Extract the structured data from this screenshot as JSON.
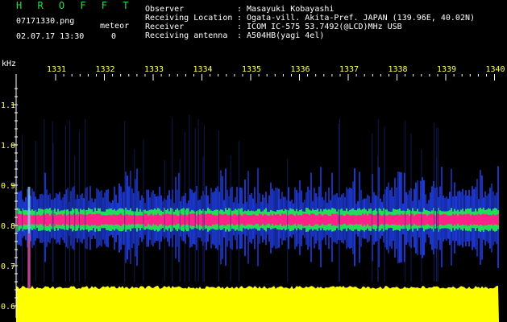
{
  "app": {
    "title": "H R O F F T"
  },
  "file": {
    "name": "07171330.png",
    "datetime": "02.07.17 13:30"
  },
  "meteor": {
    "label": "meteor",
    "count": "0"
  },
  "info": {
    "labels": [
      "Observer",
      "Receiving Location",
      "Receiver",
      "Receiving antenna"
    ],
    "values": [
      ": Masayuki Kobayashi",
      ": Ogata-vill. Akita-Pref. JAPAN (139.96E, 40.02N)",
      ": ICOM IC-575 53.7492(@LCD)MHz USB",
      ": A504HB(yagi 4el)"
    ]
  },
  "spectrogram": {
    "freq_unit": "kHz",
    "time_ticks": [
      "1331",
      "1332",
      "1333",
      "1334",
      "1335",
      "1336",
      "1337",
      "1338",
      "1339",
      "1340"
    ],
    "freq_ticks": [
      "1.1",
      "1.0",
      "0.9",
      "0.8",
      "0.7",
      "0.6"
    ],
    "colors": {
      "background": "#000000",
      "noise_floor": "#ffff00",
      "signal_core": "#ff2288",
      "signal_mid": "#22dd55",
      "signal_edge": "#2244ff",
      "tick": "#ffffff",
      "tick_label": "#ffff55"
    }
  }
}
